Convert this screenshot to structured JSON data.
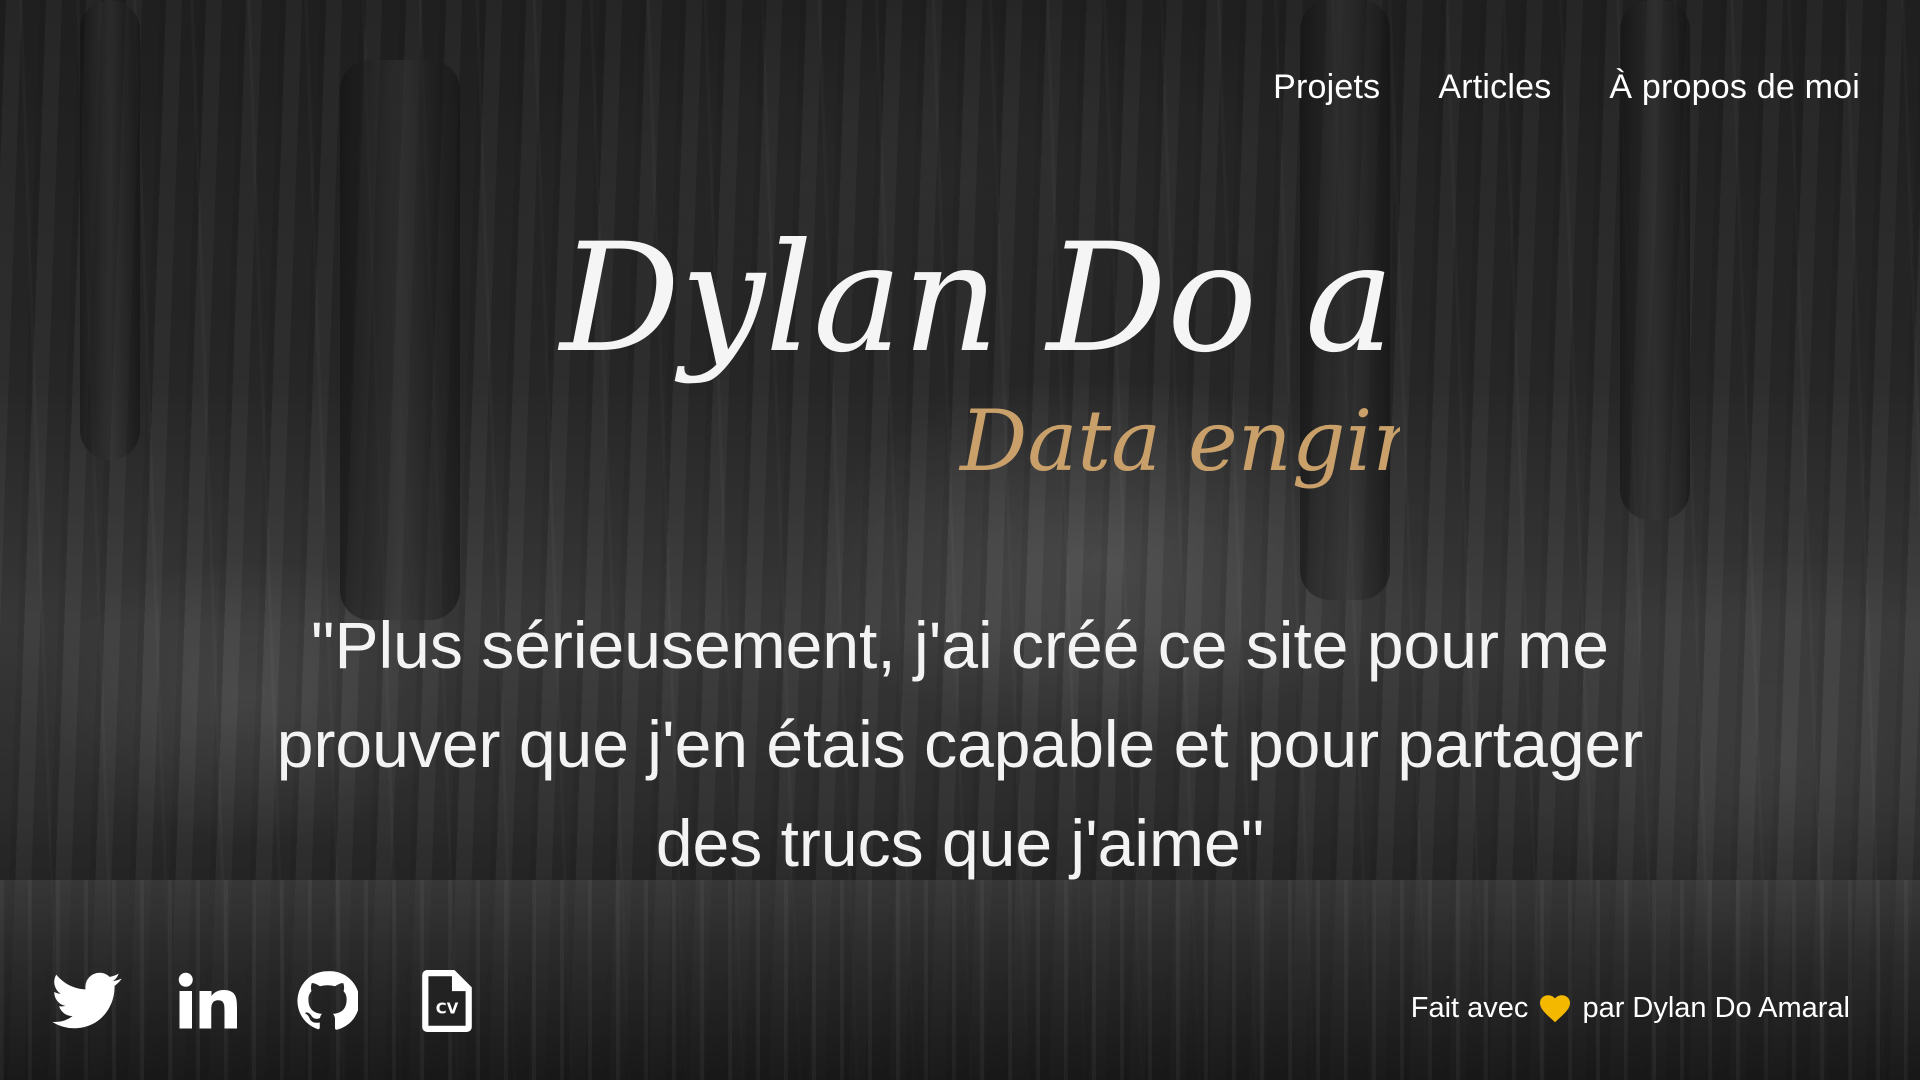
{
  "nav": {
    "items": [
      {
        "label": "Projets"
      },
      {
        "label": "Articles"
      },
      {
        "label": "À propos de moi"
      }
    ]
  },
  "hero": {
    "name": "Dylan Do amaral",
    "role": "Data engineer",
    "quote": "\"Plus sérieusement, j'ai créé ce site pour me prouver que j'en étais capable et pour partager des trucs que j'aime\""
  },
  "socials": [
    {
      "icon": "twitter-icon"
    },
    {
      "icon": "linkedin-icon"
    },
    {
      "icon": "github-icon"
    },
    {
      "icon": "cv-file-icon",
      "label": "CV"
    }
  ],
  "footer": {
    "prefix": "Fait avec",
    "heart_icon": "heart-icon",
    "suffix": "par Dylan Do Amaral"
  },
  "colors": {
    "text": "#ffffff",
    "accent_gold": "#c9a06a",
    "heart": "#f5b800"
  }
}
